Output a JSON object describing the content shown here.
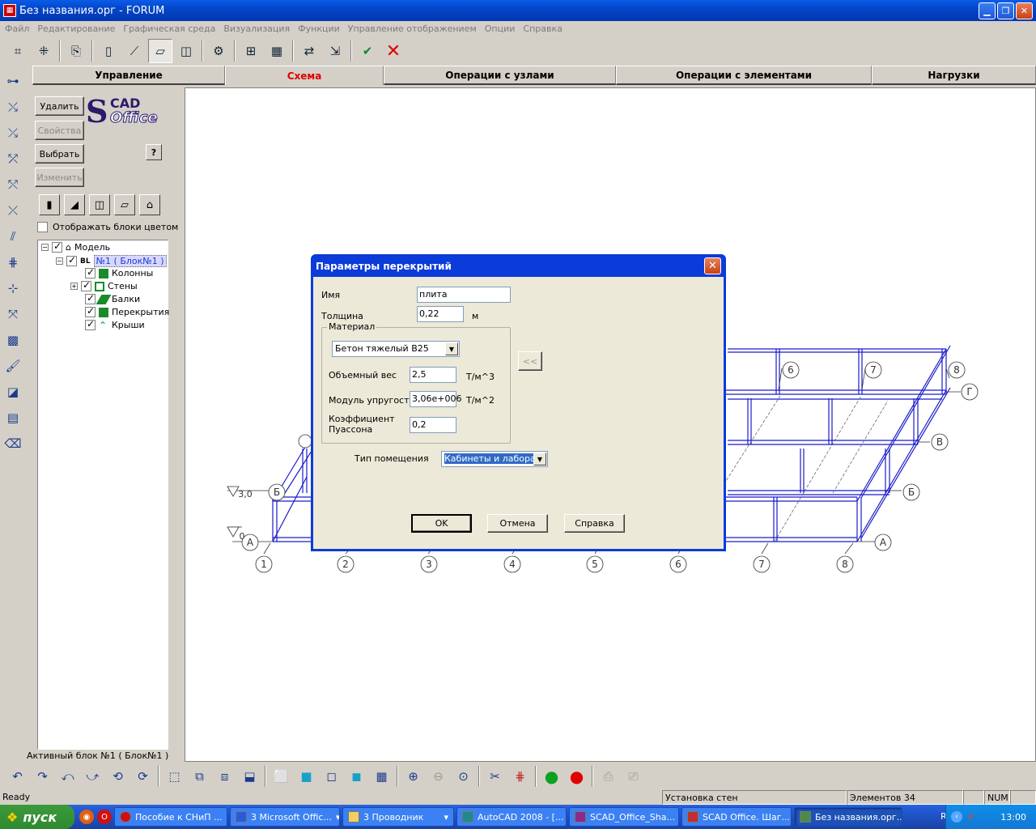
{
  "window": {
    "title": "Без названия.орг - FORUM"
  },
  "menu": [
    "Файл",
    "Редактирование",
    "Графическая среда",
    "Визуализация",
    "Функции",
    "Управление отображением",
    "Опции",
    "Справка"
  ],
  "tabs": [
    {
      "label": "Управление"
    },
    {
      "label": "Схема"
    },
    {
      "label": "Операции с узлами"
    },
    {
      "label": "Операции с элементами"
    },
    {
      "label": "Нагрузки"
    }
  ],
  "panel": {
    "delete_label": "Удалить",
    "properties_label": "Свойства",
    "select_label": "Выбрать",
    "change_label": "Изменить",
    "help_label": "?",
    "logo_s": "S",
    "logo_cad": "CAD",
    "logo_office": "Office",
    "color_blocks_label": "Отображать блоки цветом"
  },
  "tree": {
    "root": "Модель",
    "block_prefix": "BL",
    "block": "№1 ( Блок№1 )",
    "items": [
      "Колонны",
      "Стены",
      "Балки",
      "Перекрытия",
      "Крыши"
    ]
  },
  "active_block": "Активный блок №1 ( Блок№1 )",
  "dialog": {
    "title": "Параметры перекрытий",
    "name_label": "Имя",
    "name_value": "плита",
    "thickness_label": "Толщина",
    "thickness_value": "0,22",
    "thickness_unit": "м",
    "material_group": "Материал",
    "material_value": "Бетон тяжелый В25",
    "density_label": "Объемный вес",
    "density_value": "2,5",
    "density_unit": "Т/м^3",
    "modulus_label": "Модуль упругости",
    "modulus_value": "3,06e+006",
    "modulus_unit": "Т/м^2",
    "poisson_label_1": "Коэффициент",
    "poisson_label_2": "Пуассона",
    "poisson_value": "0,2",
    "back_label": "<<",
    "room_type_label": "Тип помещения",
    "room_type_value": "Кабинеты и лаборато",
    "ok_label": "OK",
    "cancel_label": "Отмена",
    "help_label": "Справка"
  },
  "drawing": {
    "front_axes": [
      "1",
      "2",
      "3",
      "4",
      "5",
      "6",
      "7",
      "8"
    ],
    "back_axes": [
      "6",
      "7",
      "8"
    ],
    "row_axes": [
      "А",
      "Б",
      "В",
      "Г"
    ],
    "level_top": "3,0",
    "level_zero": "0"
  },
  "status": {
    "ready": "Ready",
    "operation": "Установка стен",
    "elements": "Элементов 34",
    "num": "NUM"
  },
  "taskbar": {
    "start_label": "пуск",
    "tasks": [
      "Пособие к СНиП ...",
      "3 Microsoft Offic...",
      "3 Проводник",
      "AutoCAD 2008 - [...",
      "SCAD_Office_Sha...",
      "SCAD Office. Шаг...",
      "Без названия.орг..."
    ],
    "lang": "RU",
    "clock": "13:00"
  }
}
